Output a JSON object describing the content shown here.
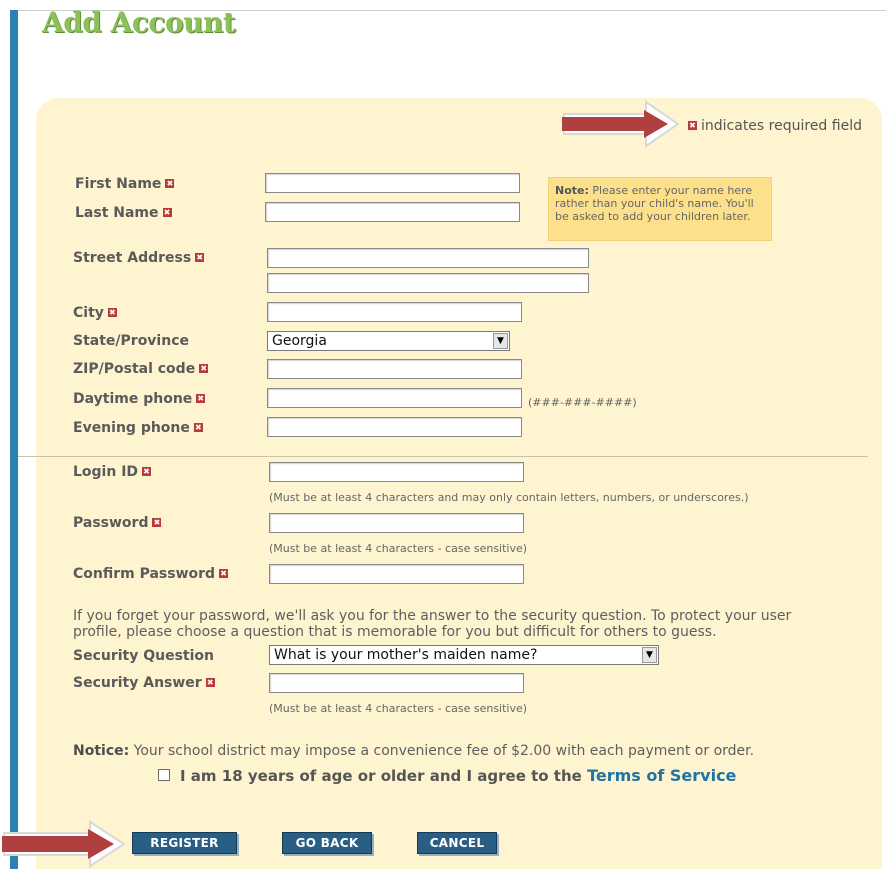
{
  "page": {
    "title": "Add Account"
  },
  "legend": {
    "marker": "✖",
    "text": "indicates required field"
  },
  "note": {
    "label": "Note:",
    "text": "Please enter your name here rather than your child's name. You'll be asked to add your children later."
  },
  "fields": {
    "first_name": {
      "label": "First Name",
      "value": ""
    },
    "last_name": {
      "label": "Last Name",
      "value": ""
    },
    "street_address": {
      "label": "Street Address",
      "value": "",
      "value2": ""
    },
    "city": {
      "label": "City",
      "value": ""
    },
    "state": {
      "label": "State/Province",
      "value": "Georgia"
    },
    "zip": {
      "label": "ZIP/Postal code",
      "value": ""
    },
    "daytime_phone": {
      "label": "Daytime phone",
      "value": "",
      "hint": "(###-###-####)"
    },
    "evening_phone": {
      "label": "Evening phone",
      "value": ""
    },
    "login_id": {
      "label": "Login ID",
      "value": "",
      "hint": "(Must be at least 4 characters and may only contain letters, numbers, or underscores.)"
    },
    "password": {
      "label": "Password",
      "value": "",
      "hint": "(Must be at least 4 characters - case sensitive)"
    },
    "confirm_password": {
      "label": "Confirm Password",
      "value": ""
    },
    "security_question": {
      "label": "Security Question",
      "value": "What is your mother's maiden name?"
    },
    "security_answer": {
      "label": "Security Answer",
      "value": "",
      "hint": "(Must be at least 4 characters - case sensitive)"
    }
  },
  "security_paragraph": "If you forget your password, we'll ask you for the answer to the security question. To protect your user profile, please choose a question that is memorable for you but difficult for others to guess.",
  "notice": {
    "label": "Notice:",
    "text": "Your school district may impose a convenience fee of $2.00 with each payment or order."
  },
  "agreement": {
    "text": "I am 18 years of age or older and I agree to the",
    "link": "Terms of Service",
    "checked": false
  },
  "buttons": {
    "register": "REGISTER",
    "go_back": "GO BACK",
    "cancel": "CANCEL"
  },
  "colors": {
    "title": "#8cc058",
    "panel": "#fff4d0",
    "accent_bar": "#2a82b0",
    "button": "#2a5f85",
    "required_marker": "#b83a3a",
    "note_bg": "#fce08c",
    "link": "#1f74a4",
    "annotation_arrow": "#b04040"
  },
  "icons": {
    "required": "required-x-icon",
    "dropdown": "chevron-down-icon",
    "annotation": "annotation-arrow-icon"
  }
}
